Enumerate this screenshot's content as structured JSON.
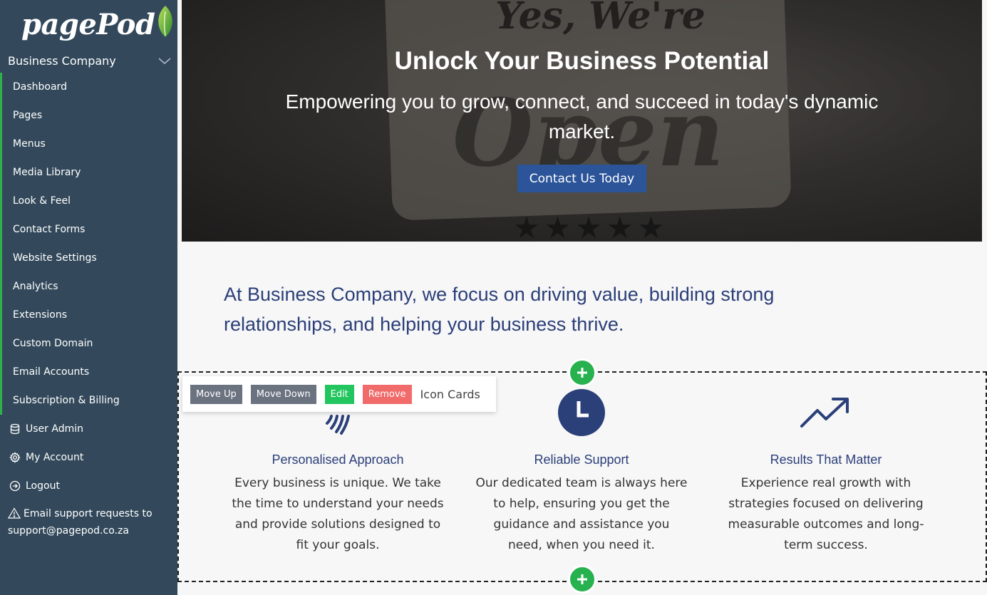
{
  "sidebar": {
    "logo": "pagePod",
    "company": "Business Company",
    "items": [
      {
        "label": "Dashboard"
      },
      {
        "label": "Pages"
      },
      {
        "label": "Menus"
      },
      {
        "label": "Media Library"
      },
      {
        "label": "Look & Feel"
      },
      {
        "label": "Contact Forms"
      },
      {
        "label": "Website Settings"
      },
      {
        "label": "Analytics"
      },
      {
        "label": "Extensions"
      },
      {
        "label": "Custom Domain"
      },
      {
        "label": "Email Accounts"
      },
      {
        "label": "Subscription & Billing"
      }
    ],
    "user_admin": "User Admin",
    "my_account": "My Account",
    "logout": "Logout",
    "support_line1": "Email support requests to",
    "support_line2": "support@pagepod.co.za"
  },
  "hero": {
    "sign_text": "Yes, We're",
    "sign_open": "Open",
    "stars": "★★★★★",
    "title": "Unlock Your Business Potential",
    "subtitle": "Empowering you to grow, connect, and succeed in today's dynamic market.",
    "cta": "Contact Us Today"
  },
  "intro": "At Business Company, we focus on driving value, building strong relationships, and helping your business thrive.",
  "toolbar": {
    "move_up": "Move Up",
    "move_down": "Move Down",
    "edit": "Edit",
    "remove": "Remove",
    "block_name": "Icon Cards"
  },
  "cards": [
    {
      "icon": "fingerprint-icon",
      "title": "Personalised Approach",
      "text": "Every business is unique. We take the time to understand your needs and provide solutions designed to fit your goals."
    },
    {
      "icon": "clock-icon",
      "title": "Reliable Support",
      "text": "Our dedicated team is always here to help, ensuring you get the guidance and assistance you need, when you need it."
    },
    {
      "icon": "trend-up-icon",
      "title": "Results That Matter",
      "text": "Experience real growth with strategies focused on delivering measurable outcomes and long-term success."
    }
  ],
  "colors": {
    "sidebar_bg": "#33495b",
    "accent_green": "#2fb04a",
    "brand_blue": "#2b3f78",
    "cta_blue": "#2b5499",
    "remove_red": "#f26b6b"
  }
}
